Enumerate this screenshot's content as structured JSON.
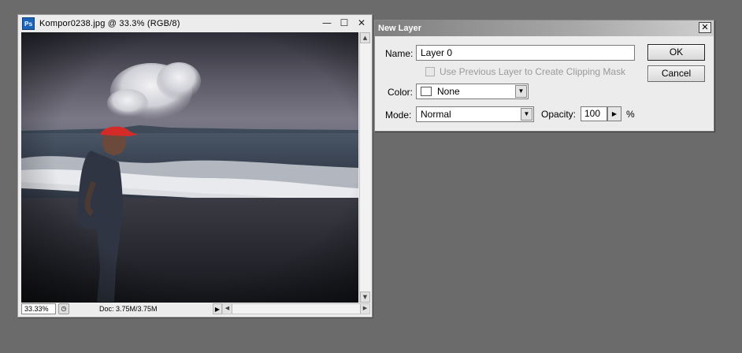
{
  "document_window": {
    "app_icon_text": "Ps",
    "title": "Kompor0238.jpg @ 33.3% (RGB/8)",
    "controls": {
      "minimize": "—",
      "maximize": "☐",
      "close": "✕"
    },
    "status": {
      "zoom": "33.33%",
      "doc_info": "Doc: 3.75M/3.75M"
    }
  },
  "new_layer_dialog": {
    "title": "New Layer",
    "close_glyph": "✕",
    "name_label": "Name:",
    "name_value": "Layer 0",
    "clipping_mask_label": "Use Previous Layer to Create Clipping Mask",
    "clipping_mask_checked": false,
    "clipping_mask_enabled": false,
    "color_label": "Color:",
    "color_value": "None",
    "mode_label": "Mode:",
    "mode_value": "Normal",
    "opacity_label": "Opacity:",
    "opacity_value": "100",
    "opacity_unit": "%",
    "ok_label": "OK",
    "cancel_label": "Cancel"
  },
  "colors": {
    "workspace_bg": "#6b6b6b",
    "panel_bg": "#ececec",
    "dialog_title_gradient_start": "#7f7f7f",
    "cap_red": "#d42a28"
  }
}
